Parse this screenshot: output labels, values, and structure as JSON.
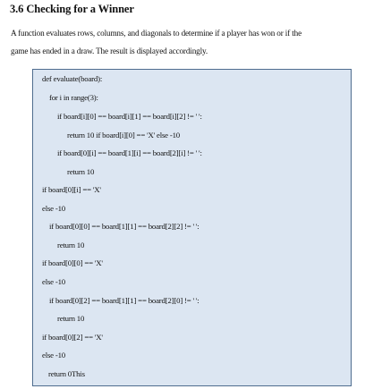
{
  "section": {
    "heading": "3.6 Checking for a Winner",
    "paragraph_lines": [
      "A function evaluates rows, columns, and diagonals to determine if a player has won or if the",
      "game has ended in a draw. The result is displayed accordingly."
    ]
  },
  "code": {
    "lines": [
      "def evaluate(board):",
      "for i in range(3):",
      "if board[i][0] == board[i][1] == board[i][2] != ' ':",
      "return 10 if board[i][0] == 'X' else -10",
      "if board[0][i] == board[1][i] == board[2][i] != ' ':",
      "return 10",
      "if board[0][i] == 'X'",
      "else -10",
      "if board[0][0] == board[1][1] == board[2][2] != ' ':",
      "return 10",
      "if board[0][0] == 'X'",
      "else -10",
      "if board[0][2] == board[1][1] == board[2][0] != ' ':",
      "return 10",
      "if board[0][2] == 'X'",
      "else -10",
      "return 0This"
    ]
  }
}
